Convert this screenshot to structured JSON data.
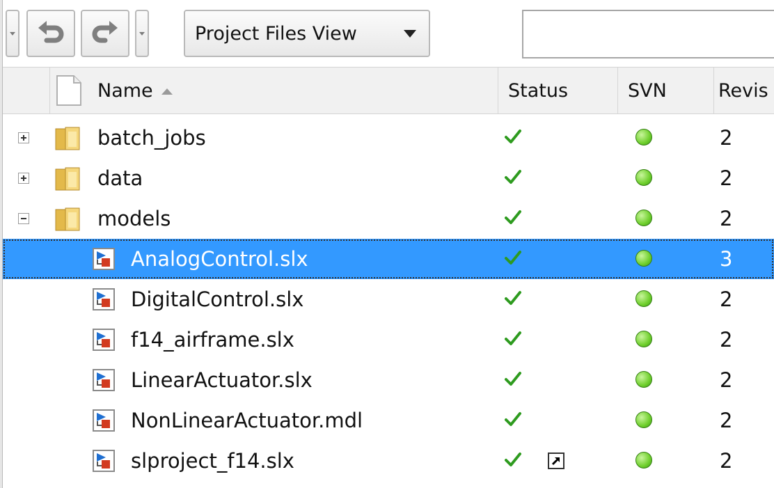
{
  "toolbar": {
    "view_label": "Project Files View",
    "icons": [
      "dropdown-icon",
      "undo-icon",
      "redo-icon",
      "dropdown-icon"
    ],
    "search_value": ""
  },
  "columns": {
    "name": "Name",
    "status": "Status",
    "svn": "SVN",
    "revision": "Revis"
  },
  "rows": [
    {
      "name": "batch_jobs",
      "type": "folder",
      "expander": "+",
      "revision": "2",
      "status": "ok",
      "svn": "normal"
    },
    {
      "name": "data",
      "type": "folder",
      "expander": "+",
      "revision": "2",
      "status": "ok",
      "svn": "normal"
    },
    {
      "name": "models",
      "type": "folder",
      "expander": "-",
      "revision": "2",
      "status": "ok",
      "svn": "normal"
    },
    {
      "name": "AnalogControl.slx",
      "type": "model",
      "revision": "3",
      "status": "ok",
      "svn": "normal",
      "selected": true
    },
    {
      "name": "DigitalControl.slx",
      "type": "model",
      "revision": "2",
      "status": "ok",
      "svn": "normal"
    },
    {
      "name": "f14_airframe.slx",
      "type": "model",
      "revision": "2",
      "status": "ok",
      "svn": "normal"
    },
    {
      "name": "LinearActuator.slx",
      "type": "model",
      "revision": "2",
      "status": "ok",
      "svn": "normal"
    },
    {
      "name": "NonLinearActuator.mdl",
      "type": "model",
      "revision": "2",
      "status": "ok",
      "svn": "normal"
    },
    {
      "name": "slproject_f14.slx",
      "type": "model",
      "revision": "2",
      "status": "ok",
      "svn": "normal",
      "shortcut": true
    }
  ],
  "colors": {
    "selection": "#3399ff",
    "check": "#2e9b1f",
    "svn_green": "#6fcf2c"
  }
}
